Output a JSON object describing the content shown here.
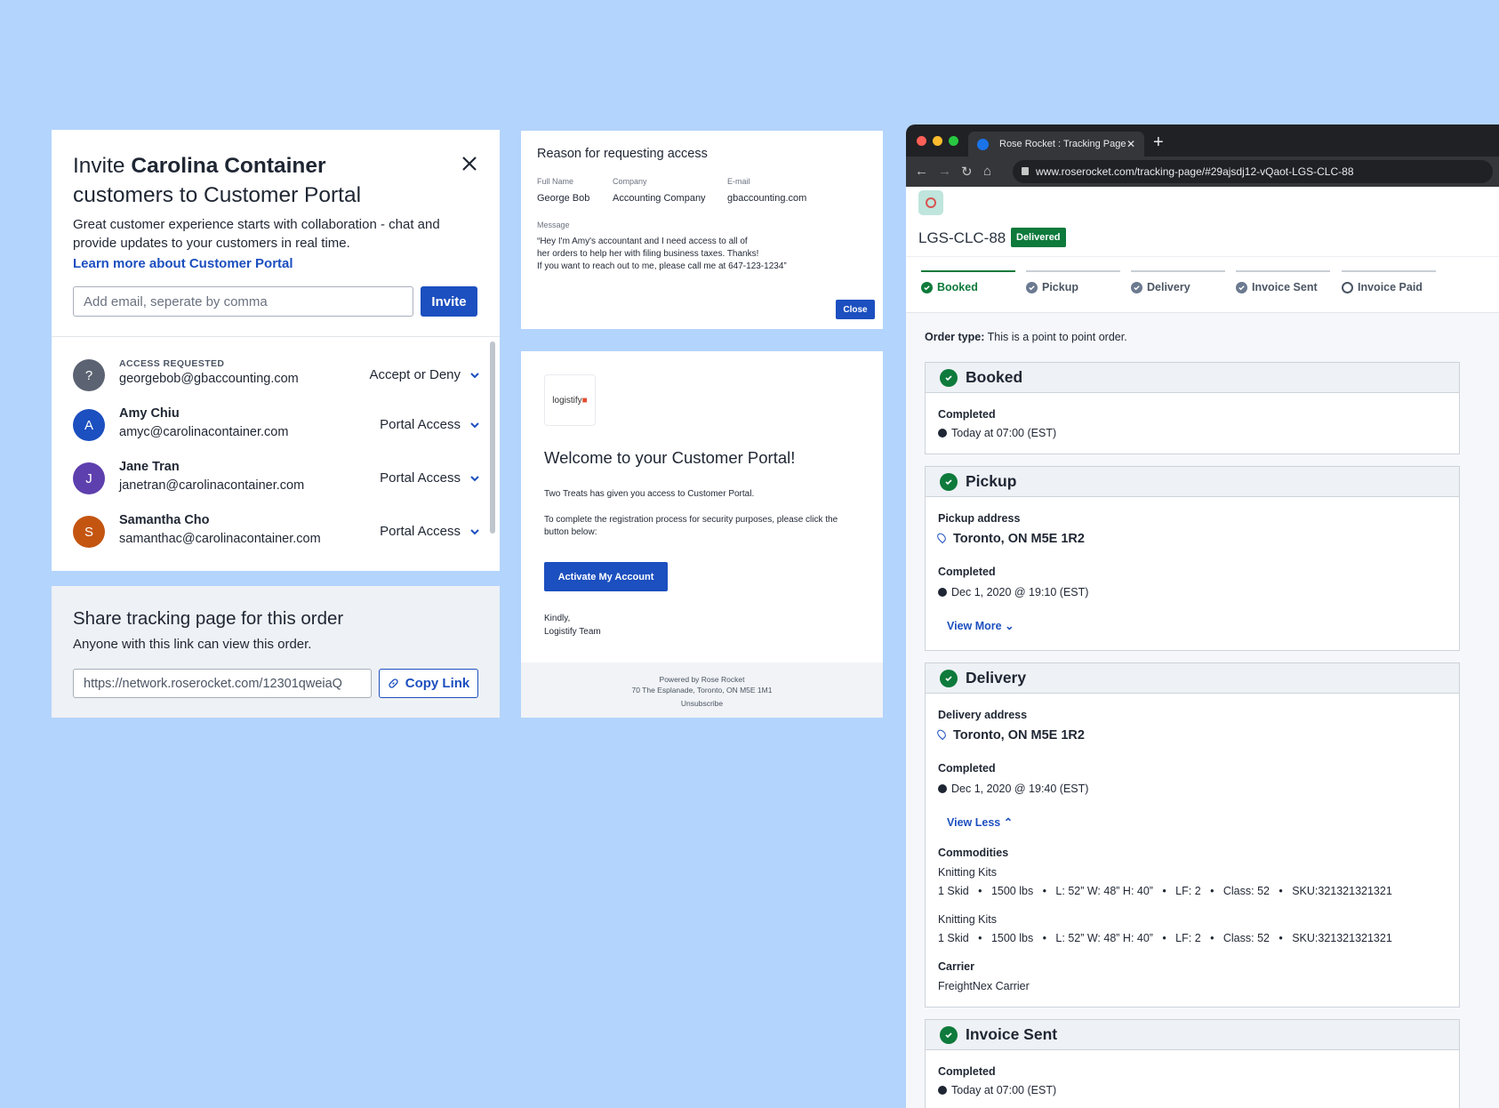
{
  "invite": {
    "title_prefix": "Invite ",
    "title_company": "Carolina Container",
    "title_suffix": " customers to Customer Portal",
    "description": "Great customer experience starts with collaboration - chat and provide updates to your customers in real time.",
    "learn_more": "Learn more about Customer Portal",
    "email_placeholder": "Add email, seperate by comma",
    "invite_button": "Invite",
    "users": [
      {
        "initial": "?",
        "kicker": "ACCESS REQUESTED",
        "name": "",
        "email": "georgebob@gbaccounting.com",
        "access": "Accept or Deny",
        "color": "#5b6372"
      },
      {
        "initial": "A",
        "kicker": "",
        "name": "Amy Chiu",
        "email": "amyc@carolinacontainer.com",
        "access": "Portal Access",
        "color": "#1c4fbf"
      },
      {
        "initial": "J",
        "kicker": "",
        "name": "Jane Tran",
        "email": "janetran@carolinacontainer.com",
        "access": "Portal Access",
        "color": "#5e3fae"
      },
      {
        "initial": "S",
        "kicker": "",
        "name": "Samantha Cho",
        "email": "samanthac@carolinacontainer.com",
        "access": "Portal Access",
        "color": "#c45511"
      }
    ]
  },
  "share": {
    "title": "Share tracking page for this order",
    "subtitle": "Anyone with this link can view this order.",
    "link": "https://network.roserocket.com/12301qweiaQ",
    "copy_button": "Copy Link"
  },
  "reason": {
    "title": "Reason for requesting access",
    "full_name_label": "Full Name",
    "full_name": "George Bob",
    "company_label": "Company",
    "company": "Accounting Company",
    "email_label": "E-mail",
    "email": "gbaccounting.com",
    "message_label": "Message",
    "message_lines": [
      "“Hey I'm Amy's accountant and I need access to all of",
      "her orders to help her with filing business taxes. Thanks!",
      "If you want to reach out to me, please call me at 647-123-1234”"
    ],
    "close_button": "Close"
  },
  "email": {
    "logo_text": "logistify",
    "title": "Welcome to your Customer Portal!",
    "p1": "Two Treats has given you access to Customer Portal.",
    "p2": "To complete the registration process for security purposes, please click the button below:",
    "button": "Activate My Account",
    "sign_1": "Kindly,",
    "sign_2": "Logistify Team",
    "footer_1": "Powered by Rose Rocket",
    "footer_2": "70 The Esplanade, Toronto, ON M5E 1M1",
    "footer_3": "Unsubscribe"
  },
  "browser": {
    "tab_title": "Rose Rocket : Tracking Page",
    "url": "www.roserocket.com/tracking-page/#29ajsdj12-vQaot-LGS-CLC-88",
    "order_id": "LGS-CLC-88",
    "status_badge": "Delivered",
    "steps": [
      "Booked",
      "Pickup",
      "Delivery",
      "Invoice Sent",
      "Invoice Paid"
    ],
    "order_type_label": "Order type:",
    "order_type": "This is a point to point order.",
    "booked": {
      "title": "Booked",
      "completed_label": "Completed",
      "time": "Today at 07:00 (EST)"
    },
    "pickup": {
      "title": "Pickup",
      "address_label": "Pickup address",
      "address": "Toronto, ON M5E 1R2",
      "completed_label": "Completed",
      "time": "Dec 1, 2020 @ 19:10 (EST)",
      "toggle": "View More"
    },
    "delivery": {
      "title": "Delivery",
      "address_label": "Delivery address",
      "address": "Toronto, ON M5E 1R2",
      "completed_label": "Completed",
      "time": "Dec 1, 2020 @ 19:40 (EST)",
      "toggle": "View Less",
      "commodities_label": "Commodities",
      "commodities": [
        {
          "name": "Knitting Kits",
          "specs": "1 Skid   •   1500 lbs   •   L: 52” W: 48” H: 40”   •   LF: 2   •   Class: 52   •   SKU:321321321321"
        },
        {
          "name": "Knitting Kits",
          "specs": "1 Skid   •   1500 lbs   •   L: 52” W: 48” H: 40”   •   LF: 2   •   Class: 52   •   SKU:321321321321"
        }
      ],
      "carrier_label": "Carrier",
      "carrier": "FreightNex Carrier"
    },
    "invoice": {
      "title": "Invoice Sent",
      "completed_label": "Completed",
      "time": "Today at 07:00 (EST)"
    }
  }
}
